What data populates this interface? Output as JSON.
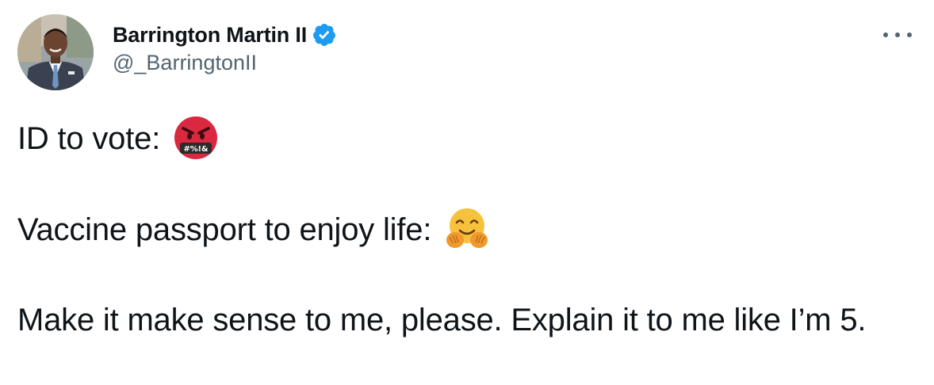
{
  "tweet": {
    "author": {
      "display_name": "Barrington Martin II",
      "handle": "@_BarringtonII",
      "verified": true,
      "avatar_icon": "profile-photo"
    },
    "more_icon": "more-horizontal-icon",
    "lines": [
      {
        "text": "ID to vote:",
        "emoji": "enraged-face-with-symbols-over-mouth"
      },
      {
        "text": "Vaccine passport to enjoy life:",
        "emoji": "hugging-face"
      },
      {
        "text": "Make it make sense to me, please. Explain it to me like I’m 5."
      }
    ],
    "emoji_symbols_text": "#%!&"
  },
  "colors": {
    "text": "#0f1419",
    "secondary": "#536471",
    "verified": "#1d9bf0",
    "background": "#ffffff"
  }
}
